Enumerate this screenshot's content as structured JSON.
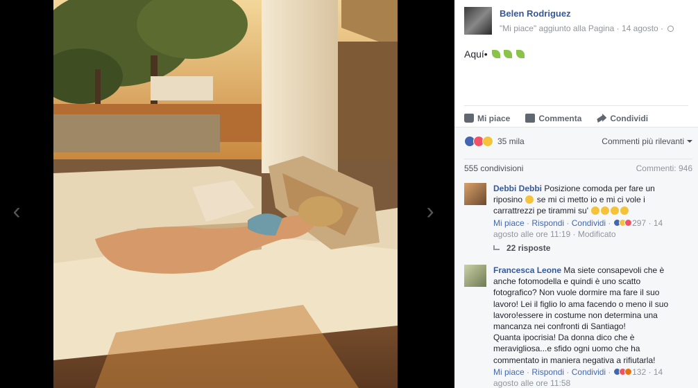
{
  "post": {
    "author": "Belen Rodriguez",
    "meta_text": "\"Mi piace\" aggiunto alla Pagina",
    "date": "14 agosto",
    "separator": "·",
    "text": "Aquí•"
  },
  "actions": {
    "like_label": "Mi piace",
    "comment_label": "Commenta",
    "share_label": "Condividi"
  },
  "stats": {
    "reactions_count": "35 mila",
    "sort_label": "Commenti più rilevanti",
    "shares_label": "555 condivisioni",
    "comments_label": "Commenti: 946"
  },
  "comments": [
    {
      "author": "Debbi Debbi",
      "line1": "Posizione comoda per fare un",
      "line2a": "riposino",
      "line2b": "se mi ci metto io e mi ci vole i",
      "line3": "carrattrezzi pe tirammi su'",
      "like_label": "Mi piace",
      "reply_label": "Rispondi",
      "share_label": "Condividi",
      "reaction_count": "297",
      "date_a": "· 14",
      "date_b": "agosto alle ore 11:19",
      "edited": "Modificato",
      "replies_label": "22 risposte"
    },
    {
      "author": "Francesca Leone",
      "text_lines": [
        "Ma siete consapevoli che è",
        "anche fotomodella e quindi è uno scatto",
        "fotografico? Non vuole dormire ma fare il suo",
        "lavoro! Lei il figlio lo ama facendo o meno il suo",
        "lavoro!essere in costume non determina una",
        "mancanza nei confronti di Santiago!",
        "Quanta ipocrisia! Da donna dico che è",
        "meravigliosa...e sfido ogni uomo che ha",
        "commentato in maniera negativa a rifiutarla!"
      ],
      "like_label": "Mi piace",
      "reply_label": "Rispondi",
      "share_label": "Condividi",
      "reaction_count": "132",
      "date_a": "· 14",
      "date_b": "agosto alle ore 11:58"
    }
  ],
  "colors": {
    "link": "#365899",
    "muted": "#90949c",
    "background": "#f6f7f9",
    "photo_warm": "#c88a4a"
  }
}
